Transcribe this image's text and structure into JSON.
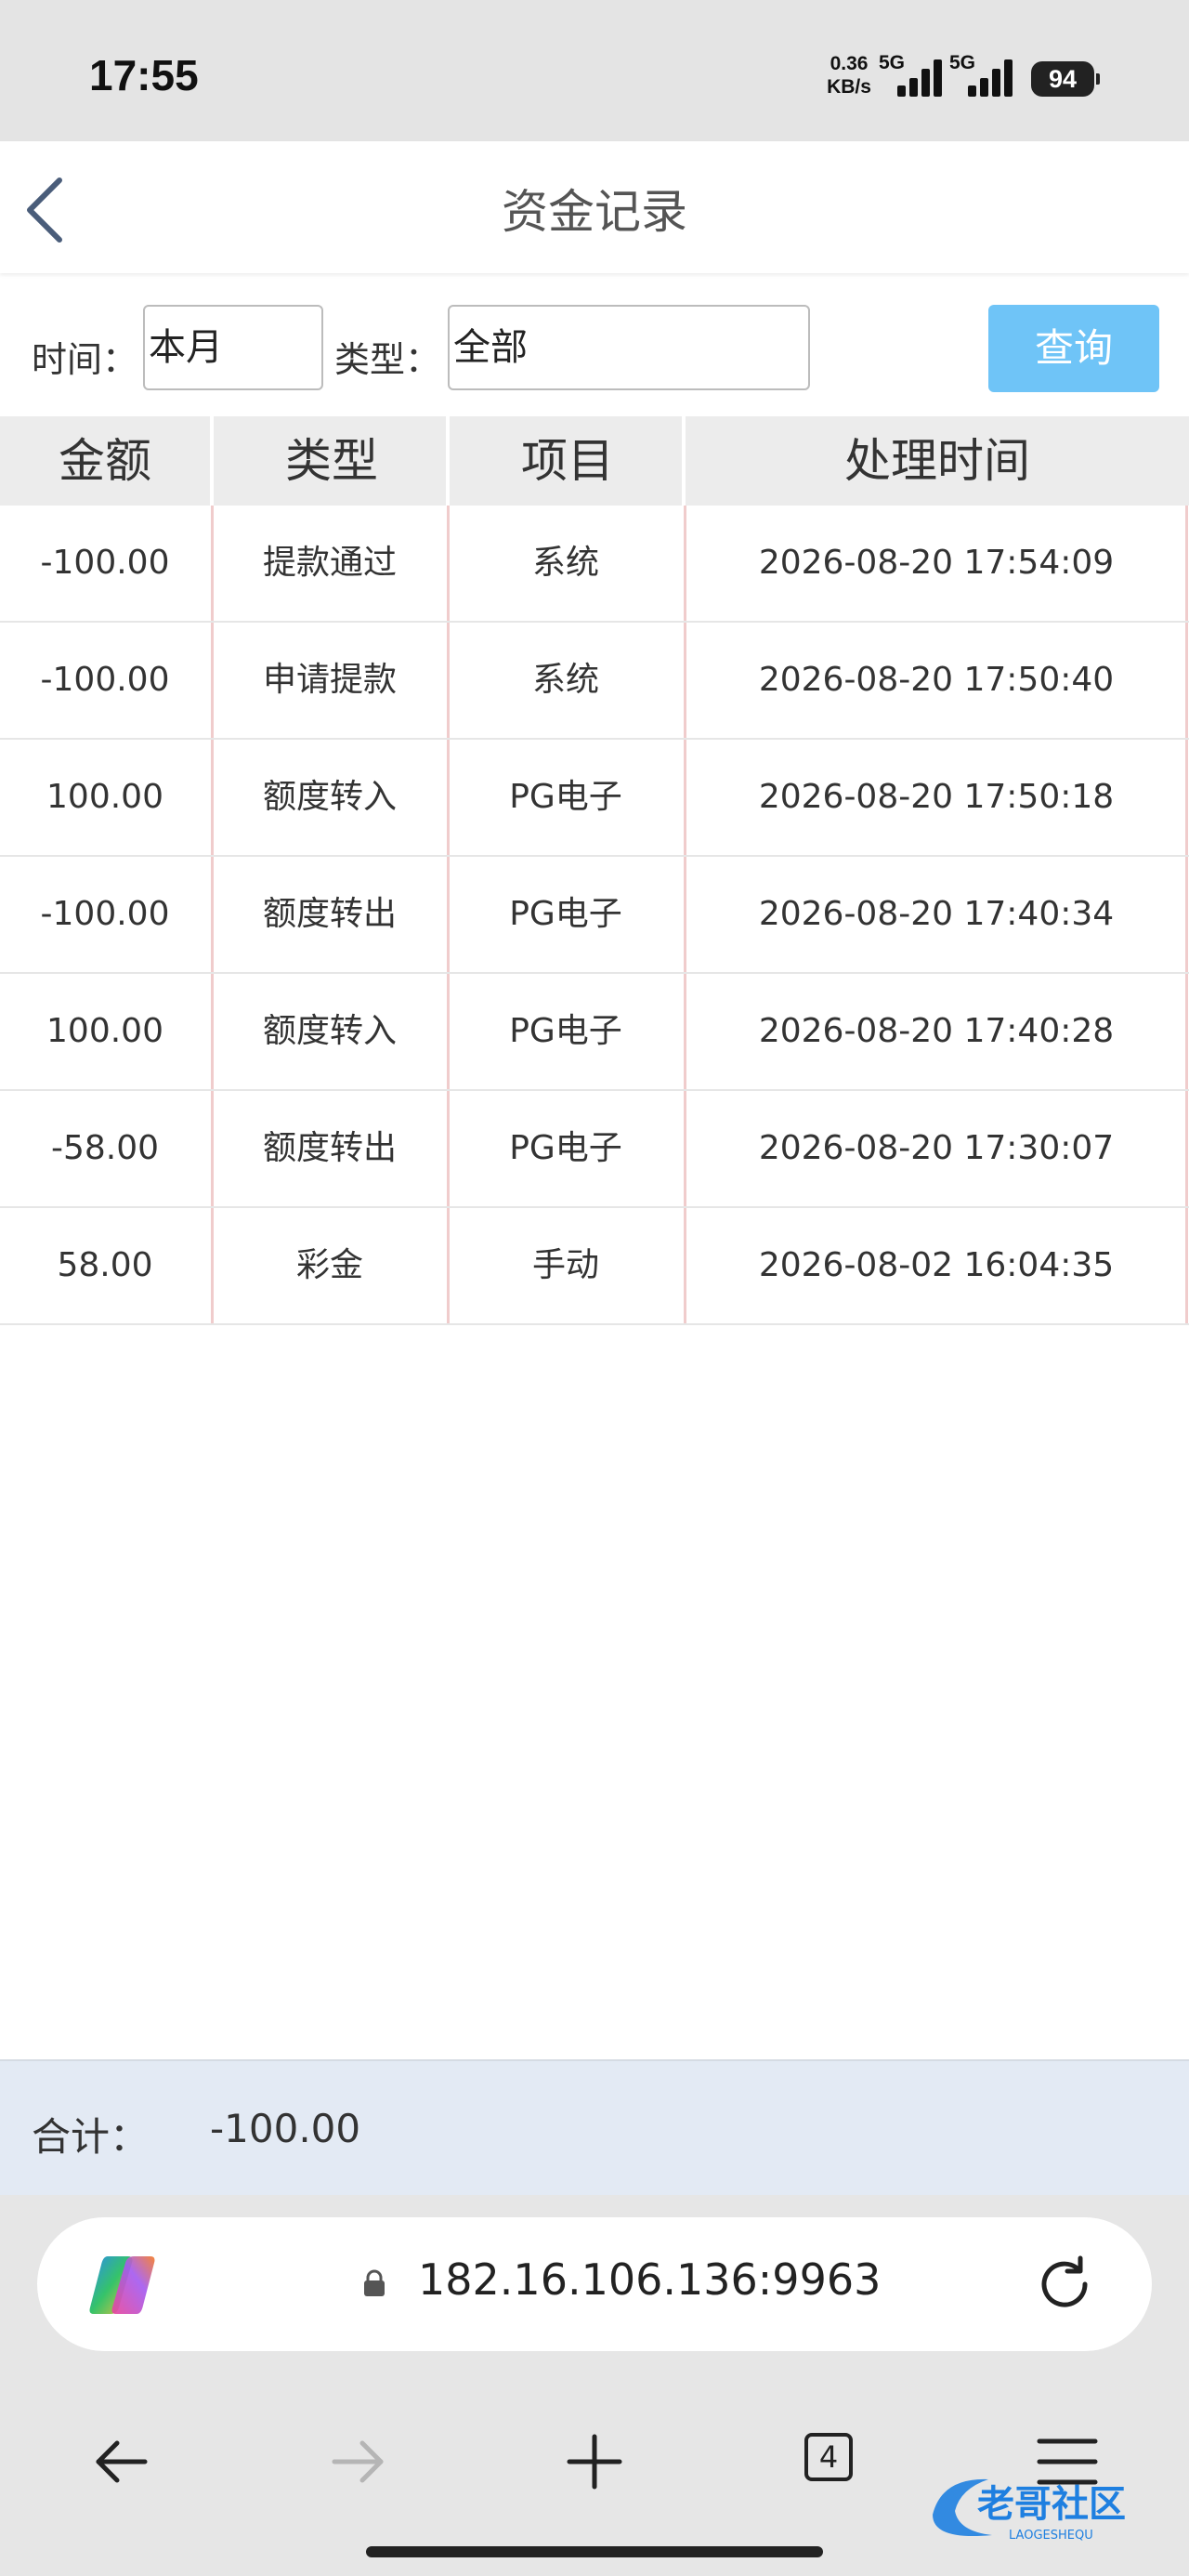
{
  "status_bar": {
    "time": "17:55",
    "net_speed_value": "0.36",
    "net_speed_unit": "KB/s",
    "sim1": "5G",
    "sim2": "5G",
    "battery": "94"
  },
  "header": {
    "title": "资金记录",
    "back_icon": "chevron-left-icon"
  },
  "filter": {
    "time_label": "时间：",
    "time_value": "本月",
    "type_label": "类型：",
    "type_value": "全部",
    "query_button": "查询"
  },
  "table": {
    "columns": [
      "金额",
      "类型",
      "项目",
      "处理时间"
    ],
    "rows": [
      {
        "amount": "-100.00",
        "type": "提款通过",
        "item": "系统",
        "time": "2026-08-20 17:54:09"
      },
      {
        "amount": "-100.00",
        "type": "申请提款",
        "item": "系统",
        "time": "2026-08-20 17:50:40"
      },
      {
        "amount": "100.00",
        "type": "额度转入",
        "item": "PG电子",
        "time": "2026-08-20 17:50:18"
      },
      {
        "amount": "-100.00",
        "type": "额度转出",
        "item": "PG电子",
        "time": "2026-08-20 17:40:34"
      },
      {
        "amount": "100.00",
        "type": "额度转入",
        "item": "PG电子",
        "time": "2026-08-20 17:40:28"
      },
      {
        "amount": "-58.00",
        "type": "额度转出",
        "item": "PG电子",
        "time": "2026-08-20 17:30:07"
      },
      {
        "amount": "58.00",
        "type": "彩金",
        "item": "手动",
        "time": "2026-08-02 16:04:35"
      }
    ]
  },
  "total": {
    "label": "合计：",
    "value": "-100.00"
  },
  "browser": {
    "url": "182.16.106.136:9963",
    "tabs_count": "4",
    "icons": [
      "copilot-icon",
      "lock-icon",
      "reload-icon",
      "back-arrow-icon",
      "forward-arrow-icon",
      "new-tab-plus-icon",
      "tabs-icon",
      "menu-icon"
    ]
  },
  "watermark": {
    "text": "老哥社区",
    "subtext": "LAOGESHEQU"
  },
  "colors": {
    "query_button": "#6fc4f7",
    "total_bar": "#e3eaf4",
    "table_header": "#ececec",
    "column_divider": "#f0cccc"
  }
}
